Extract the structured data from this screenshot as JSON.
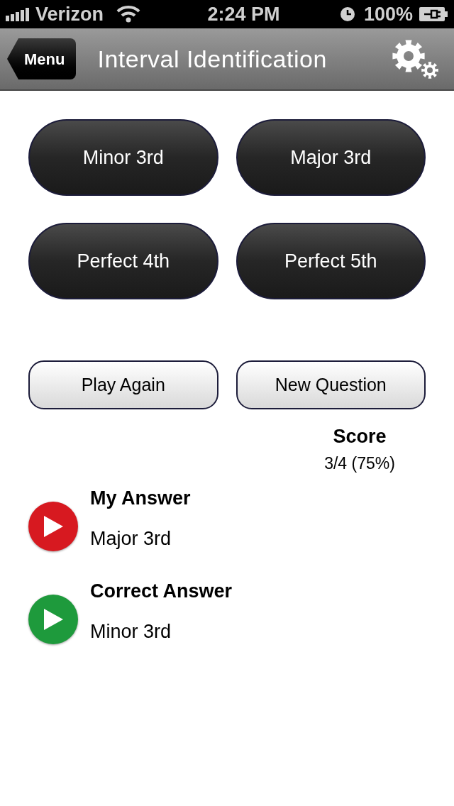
{
  "status_bar": {
    "carrier": "Verizon",
    "time": "2:24 PM",
    "battery": "100%"
  },
  "nav_bar": {
    "back": "Menu",
    "title": "Interval Identification"
  },
  "choices": [
    "Minor 3rd",
    "Major 3rd",
    "Perfect 4th",
    "Perfect 5th"
  ],
  "actions": [
    "Play Again",
    "New Question"
  ],
  "score": {
    "label": "Score",
    "value": "3/4 (75%)"
  },
  "answers": [
    {
      "title": "My Answer",
      "value": "Major 3rd",
      "color": "#d71920"
    },
    {
      "title": "Correct Answer",
      "value": "Minor 3rd",
      "color": "#1e9a3c"
    }
  ]
}
